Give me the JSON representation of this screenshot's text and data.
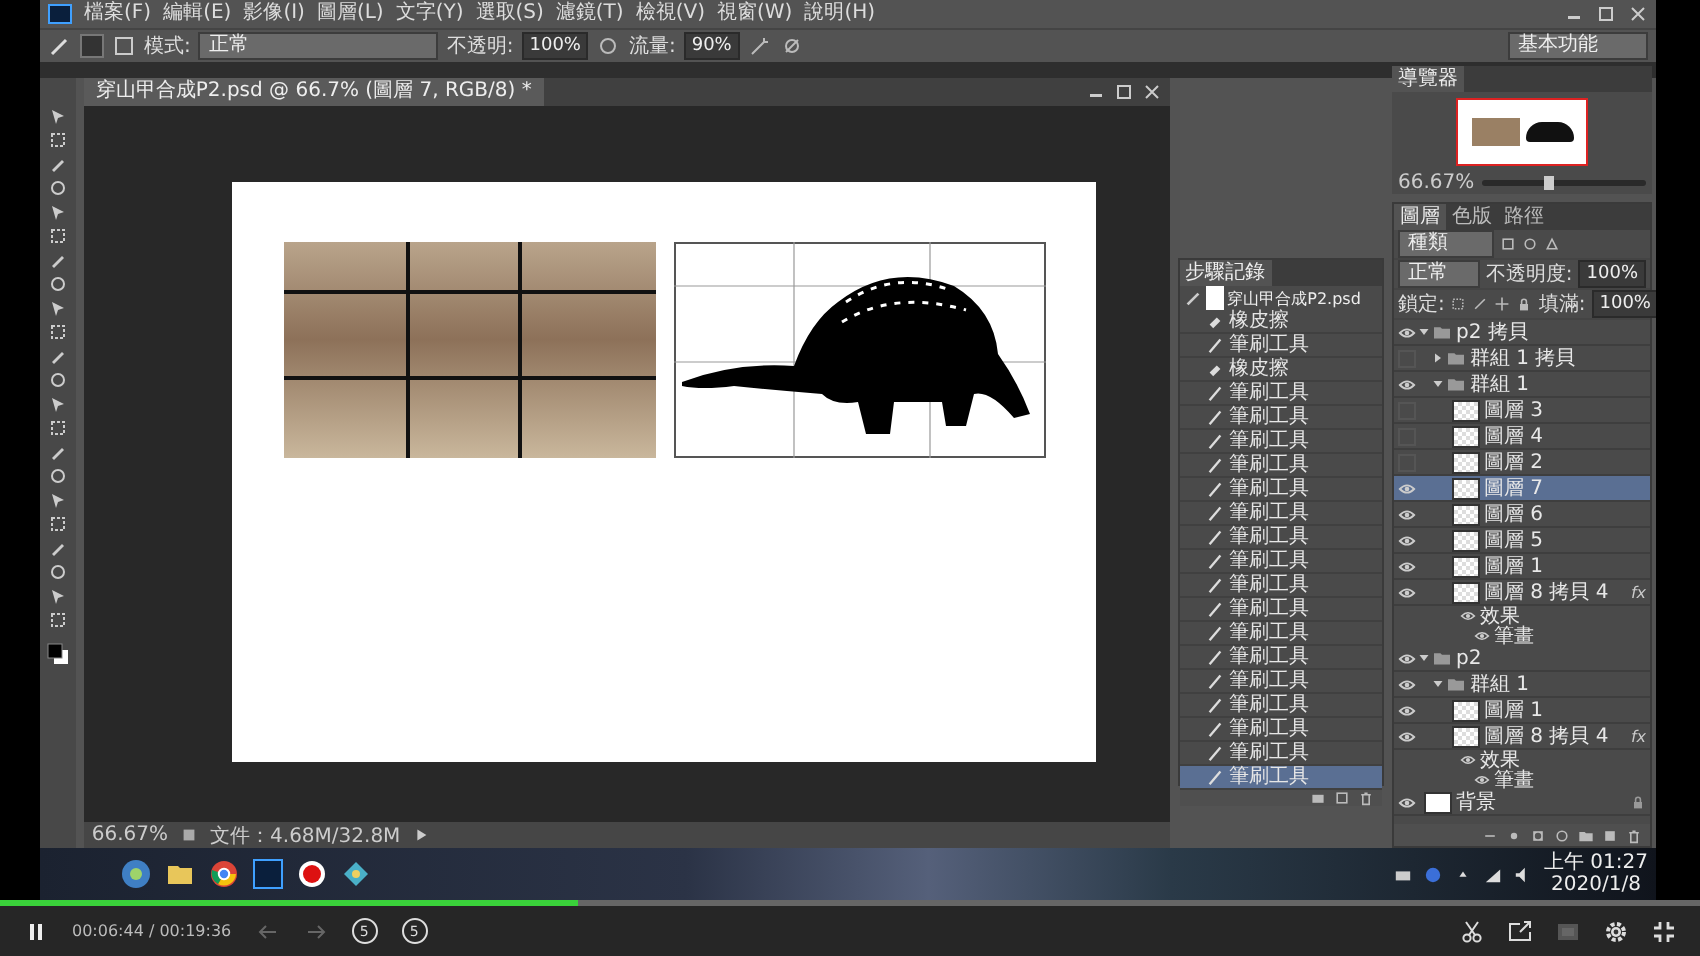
{
  "menu": [
    "檔案(F)",
    "編輯(E)",
    "影像(I)",
    "圖層(L)",
    "文字(Y)",
    "選取(S)",
    "濾鏡(T)",
    "檢視(V)",
    "視窗(W)",
    "說明(H)"
  ],
  "options": {
    "mode_label": "模式:",
    "mode": "正常",
    "opacity_label": "不透明:",
    "opacity": "100%",
    "flow_label": "流量:",
    "flow": "90%",
    "workspace": "基本功能"
  },
  "document": {
    "tab": "穿山甲合成P2.psd @ 66.7% (圖層 7, RGB/8) *",
    "zoom": "66.67%",
    "doc_size": "文件：4.68M/32.8M"
  },
  "navigator": {
    "title": "導覽器",
    "zoom": "66.67%",
    "level": 0.4
  },
  "history": {
    "title": "步驟記錄",
    "snapshot": "穿山甲合成P2.psd",
    "items": [
      {
        "label": "橡皮擦",
        "kind": "eraser",
        "selected": false
      },
      {
        "label": "筆刷工具",
        "kind": "brush",
        "selected": false
      },
      {
        "label": "橡皮擦",
        "kind": "eraser",
        "selected": false
      },
      {
        "label": "筆刷工具",
        "kind": "brush",
        "selected": false
      },
      {
        "label": "筆刷工具",
        "kind": "brush",
        "selected": false
      },
      {
        "label": "筆刷工具",
        "kind": "brush",
        "selected": false
      },
      {
        "label": "筆刷工具",
        "kind": "brush",
        "selected": false
      },
      {
        "label": "筆刷工具",
        "kind": "brush",
        "selected": false
      },
      {
        "label": "筆刷工具",
        "kind": "brush",
        "selected": false
      },
      {
        "label": "筆刷工具",
        "kind": "brush",
        "selected": false
      },
      {
        "label": "筆刷工具",
        "kind": "brush",
        "selected": false
      },
      {
        "label": "筆刷工具",
        "kind": "brush",
        "selected": false
      },
      {
        "label": "筆刷工具",
        "kind": "brush",
        "selected": false
      },
      {
        "label": "筆刷工具",
        "kind": "brush",
        "selected": false
      },
      {
        "label": "筆刷工具",
        "kind": "brush",
        "selected": false
      },
      {
        "label": "筆刷工具",
        "kind": "brush",
        "selected": false
      },
      {
        "label": "筆刷工具",
        "kind": "brush",
        "selected": false
      },
      {
        "label": "筆刷工具",
        "kind": "brush",
        "selected": false
      },
      {
        "label": "筆刷工具",
        "kind": "brush",
        "selected": false
      },
      {
        "label": "筆刷工具",
        "kind": "brush",
        "selected": true
      }
    ]
  },
  "layers": {
    "tabs": [
      {
        "label": "圖層",
        "selected": true
      },
      {
        "label": "色版",
        "selected": false
      },
      {
        "label": "路徑",
        "selected": false
      }
    ],
    "filter": "種類",
    "blend": "正常",
    "opacity_label": "不透明度:",
    "opacity": "100%",
    "lock_label": "鎖定:",
    "fill_label": "填滿:",
    "fill": "100%",
    "items": [
      {
        "name": "p2 拷貝",
        "kind": "group",
        "visible": true,
        "expanded": true,
        "selected": false,
        "children": [
          {
            "name": "群組 1 拷貝",
            "kind": "group",
            "visible": false,
            "expanded": false,
            "selected": false
          },
          {
            "name": "群組 1",
            "kind": "group",
            "visible": true,
            "expanded": true,
            "selected": false,
            "children": [
              {
                "name": "圖層 3",
                "kind": "layer",
                "visible": false,
                "selected": false
              },
              {
                "name": "圖層 4",
                "kind": "layer",
                "visible": false,
                "selected": false
              },
              {
                "name": "圖層 2",
                "kind": "layer",
                "visible": false,
                "selected": false
              },
              {
                "name": "圖層 7",
                "kind": "layer",
                "visible": true,
                "selected": true
              },
              {
                "name": "圖層 6",
                "kind": "layer",
                "visible": true,
                "selected": false
              },
              {
                "name": "圖層 5",
                "kind": "layer",
                "visible": true,
                "selected": false
              },
              {
                "name": "圖層 1",
                "kind": "layer",
                "visible": true,
                "selected": false
              },
              {
                "name": "圖層 8 拷貝 4",
                "kind": "layer",
                "visible": true,
                "selected": false,
                "badge": "fx",
                "children": [
                  {
                    "name": "效果",
                    "kind": "effects",
                    "visible": true,
                    "children": [
                      {
                        "name": "筆畫",
                        "kind": "effect",
                        "visible": true
                      }
                    ]
                  }
                ]
              }
            ]
          }
        ]
      },
      {
        "name": "p2",
        "kind": "group",
        "visible": true,
        "expanded": true,
        "selected": false,
        "children": [
          {
            "name": "群組 1",
            "kind": "group",
            "visible": true,
            "expanded": true,
            "selected": false,
            "children": [
              {
                "name": "圖層 1",
                "kind": "layer",
                "visible": true,
                "selected": false
              },
              {
                "name": "圖層 8 拷貝 4",
                "kind": "layer",
                "visible": true,
                "selected": false,
                "badge": "fx",
                "children": [
                  {
                    "name": "效果",
                    "kind": "effects",
                    "visible": true,
                    "children": [
                      {
                        "name": "筆畫",
                        "kind": "effect",
                        "visible": true
                      }
                    ]
                  }
                ]
              }
            ]
          }
        ]
      },
      {
        "name": "背景",
        "kind": "background",
        "visible": true,
        "selected": false
      }
    ]
  },
  "taskbar": {
    "clock": "上午 01:27",
    "date": "2020/1/8"
  },
  "player": {
    "playing": true,
    "time": "00:06:44 / 00:19:36",
    "level": 0.34,
    "rewind": "5",
    "forward": "5"
  }
}
